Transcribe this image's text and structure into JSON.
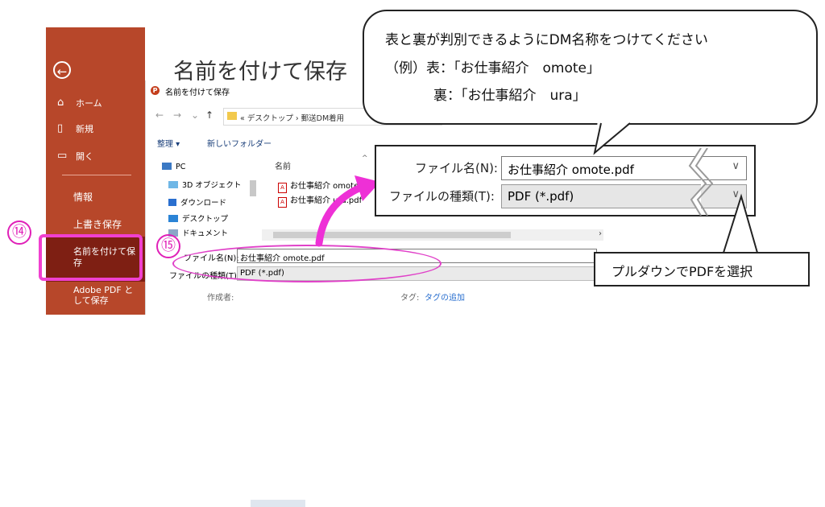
{
  "backstage": {
    "back_icon": "back-arrow-icon",
    "home": "ホーム",
    "new": "新規",
    "open": "開く",
    "info": "情報",
    "overwrite_save": "上書き保存",
    "save_as": "名前を付けて保存",
    "adobe_pdf": "Adobe PDF として保存"
  },
  "page_title": "名前を付けて保存",
  "dialog": {
    "title": "名前を付けて保存",
    "address": "« デスクトップ › 郵送DM着用",
    "organize": "整理 ▾",
    "new_folder": "新しいフォルダー",
    "nav": [
      "PC",
      "3D オブジェクト",
      "ダウンロード",
      "デスクトップ",
      "ドキュメント"
    ],
    "column_name": "名前",
    "files": [
      "お仕事紹介 omote.pdf",
      "お仕事紹介 ura.pdf"
    ],
    "file_name_label": "ファイル名(N):",
    "file_name_value": "お仕事紹介 omote.pdf",
    "file_type_label": "ファイルの種類(T):",
    "file_type_value": "PDF (*.pdf)",
    "author_label": "作成者:",
    "tags_label": "タグ:",
    "tags_link": "タグの追加"
  },
  "zoom": {
    "file_name_label": "ファイル名(N):",
    "file_name_value": "お仕事紹介 omote.pdf",
    "file_type_label": "ファイルの種類(T):",
    "file_type_value": "PDF (*.pdf)"
  },
  "bubble": {
    "line1": "表と裏が判別できるようにDM名称をつけてください",
    "line2": "（例）表：「お仕事紹介　omote」",
    "line3": "裏：「お仕事紹介　ura」"
  },
  "dropdown_note": "プルダウンでPDFを選択",
  "step14": "⑭",
  "step15": "⑮",
  "colors": {
    "backstage": "#b7472a",
    "backstage_selected": "#7e1f13",
    "highlight": "#f040d0"
  }
}
